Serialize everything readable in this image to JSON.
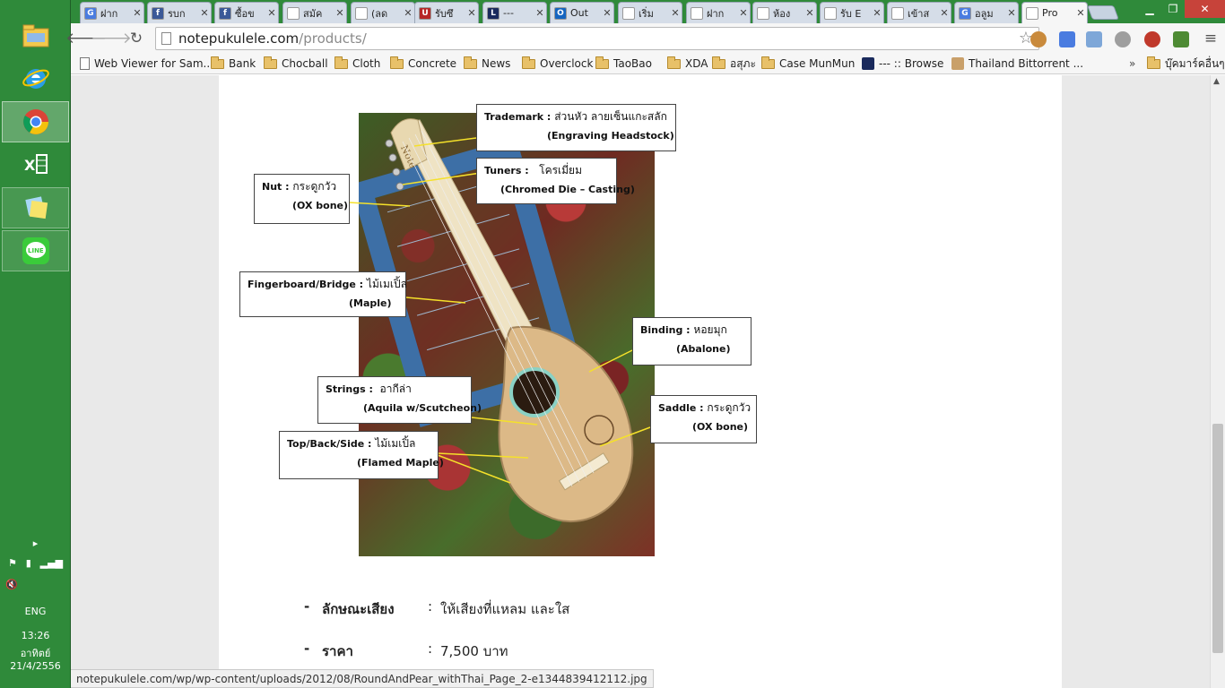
{
  "taskbar": {
    "apps": [
      {
        "name": "file-explorer-icon"
      },
      {
        "name": "internet-explorer-icon"
      },
      {
        "name": "chrome-icon"
      },
      {
        "name": "excel-icon"
      },
      {
        "name": "sticky-notes-icon"
      },
      {
        "name": "line-app-icon"
      }
    ],
    "language": "ENG",
    "time": "13:26",
    "day": "อาทิตย์",
    "date": "21/4/2556"
  },
  "tabs": [
    {
      "title": "ฝาก",
      "fav": "G",
      "color": "#4a7ce0"
    },
    {
      "title": "รบก",
      "fav": "f",
      "color": "#3b5998"
    },
    {
      "title": "ซื้อข",
      "fav": "f",
      "color": "#3b5998"
    },
    {
      "title": "สมัค",
      "fav": "",
      "color": "#ffffff"
    },
    {
      "title": "(ลด",
      "fav": "",
      "color": "#ffffff"
    },
    {
      "title": "รับซึ",
      "fav": "U",
      "color": "#b72626"
    },
    {
      "title": "---",
      "fav": "L",
      "color": "#1a2a5c"
    },
    {
      "title": "Out",
      "fav": "O",
      "color": "#1565c0"
    },
    {
      "title": "เริ่ม",
      "fav": "",
      "color": "#ffffff"
    },
    {
      "title": "ฝาก",
      "fav": "",
      "color": "#ffffff"
    },
    {
      "title": "ห้อง",
      "fav": "",
      "color": "#ffffff"
    },
    {
      "title": "รับ E",
      "fav": "",
      "color": "#ffffff"
    },
    {
      "title": "เข้าส",
      "fav": "",
      "color": "#ffffff"
    },
    {
      "title": "อลูม",
      "fav": "G",
      "color": "#4a7ce0"
    },
    {
      "title": "Pro",
      "fav": "",
      "color": "#ffffff",
      "active": true
    }
  ],
  "toolbar": {
    "url_host": "notepukulele.com",
    "url_path": "/products/"
  },
  "bookmarks": [
    {
      "label": "Web Viewer for Sam...",
      "type": "page"
    },
    {
      "label": "Bank",
      "type": "folder"
    },
    {
      "label": "Chocball",
      "type": "folder"
    },
    {
      "label": "Cloth",
      "type": "folder"
    },
    {
      "label": "Concrete",
      "type": "folder"
    },
    {
      "label": "News",
      "type": "folder"
    },
    {
      "label": "Overclock",
      "type": "folder"
    },
    {
      "label": "TaoBao",
      "type": "folder"
    },
    {
      "label": "XDA",
      "type": "folder"
    },
    {
      "label": "อสุภะ",
      "type": "folder"
    },
    {
      "label": "Case MunMun",
      "type": "folder"
    },
    {
      "label": "--- :: Browse",
      "type": "site"
    },
    {
      "label": "Thailand Bittorrent ...",
      "type": "site"
    }
  ],
  "bookmarks_overflow": "»",
  "bookmarks_other": "บุ๊คมาร์คอื่นๆ",
  "figure": {
    "labels": [
      {
        "key": "Trademark :",
        "th": "ส่วนหัว ลายเซ็นแกะสลัก",
        "en": "(Engraving Headstock)"
      },
      {
        "key": "Tuners :",
        "th": "โครเมี่ยม",
        "en": "(Chromed Die – Casting)"
      },
      {
        "key": "Nut :",
        "th": "กระดูกวัว",
        "en": "(OX bone)"
      },
      {
        "key": "Fingerboard/Bridge :",
        "th": "ไม้เมเปิ้ล",
        "en": "(Maple)"
      },
      {
        "key": "Binding :",
        "th": "หอยมุก",
        "en": "(Abalone)"
      },
      {
        "key": "Strings :",
        "th": "อากีล่า",
        "en": "(Aquila w/Scutcheon)"
      },
      {
        "key": "Saddle :",
        "th": "กระดูกวัว",
        "en": "(OX bone)"
      },
      {
        "key": "Top/Back/Side :",
        "th": "ไม้เมเปิ้ล",
        "en": "(Flamed Maple)"
      }
    ],
    "headstock_text": "Note"
  },
  "specs": [
    {
      "dash": "-",
      "key": "ลักษณะเสียง",
      "sep": ":",
      "value": "ให้เสียงที่แหลม และใส"
    },
    {
      "dash": "-",
      "key": "ราคา",
      "sep": ":",
      "value": "7,500  บาท"
    }
  ],
  "status_url": "notepukulele.com/wp/wp-content/uploads/2012/08/RoundAndPear_withThai_Page_2-e1344839412112.jpg"
}
